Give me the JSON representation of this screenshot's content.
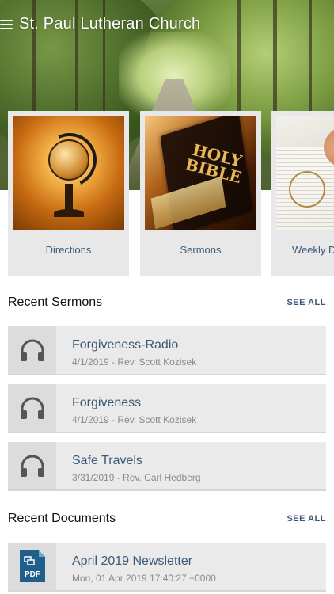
{
  "header": {
    "title": "St. Paul Lutheran Church",
    "menu_icon": "hamburger-menu-icon"
  },
  "cards": [
    {
      "label": "Directions",
      "image": "globe"
    },
    {
      "label": "Sermons",
      "image": "holy-bible",
      "image_text": "HOLY BIBLE"
    },
    {
      "label": "Weekly De",
      "image": "newspaper-glasses"
    }
  ],
  "recent_sermons": {
    "title": "Recent Sermons",
    "see_all": "SEE ALL",
    "items": [
      {
        "title": "Forgiveness-Radio",
        "meta": "4/1/2019 - Rev. Scott Kozisek",
        "icon": "headphones-icon"
      },
      {
        "title": "Forgiveness",
        "meta": "4/1/2019 - Rev. Scott Kozisek",
        "icon": "headphones-icon"
      },
      {
        "title": "Safe Travels",
        "meta": "3/31/2019 - Rev. Carl Hedberg",
        "icon": "headphones-icon"
      }
    ]
  },
  "recent_documents": {
    "title": "Recent Documents",
    "see_all": "SEE ALL",
    "items": [
      {
        "title": "April 2019 Newsletter",
        "meta": "Mon, 01 Apr 2019 17:40:27 +0000",
        "icon": "pdf-document-icon",
        "icon_text": "PDF"
      }
    ]
  },
  "colors": {
    "accent": "#3c5a78",
    "card_bg": "#e8e8e8",
    "list_bg": "#eaeaea",
    "icon_gray": "#555555",
    "pdf_blue": "#1f5f8a"
  }
}
